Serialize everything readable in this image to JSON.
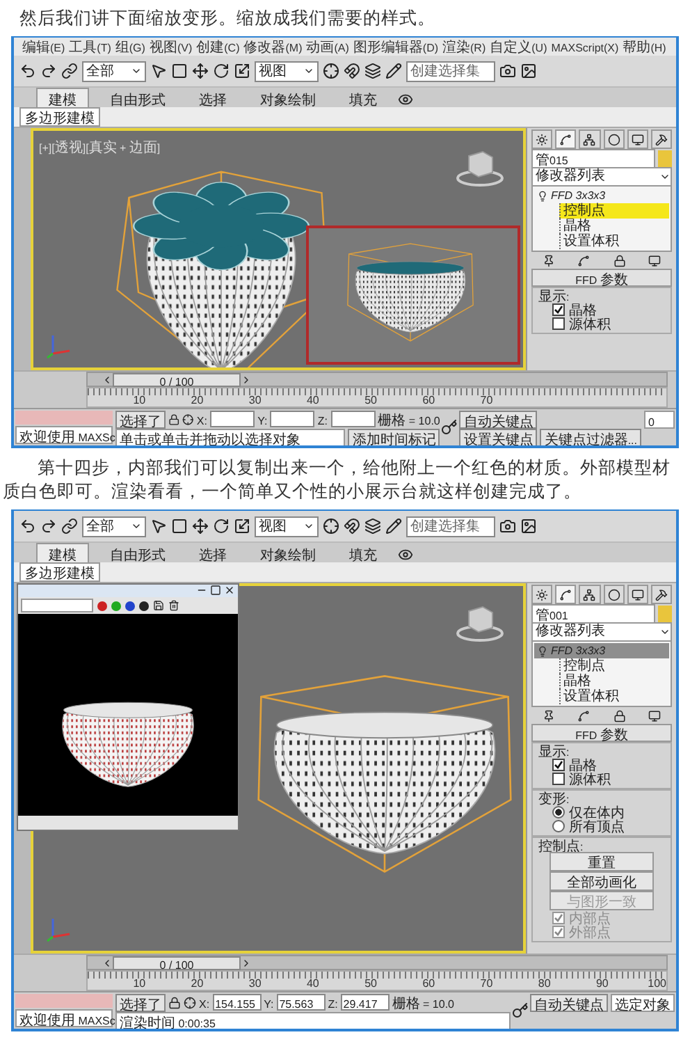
{
  "heading": "然后我们讲下面缩放变形。缩放成我们需要的样式。",
  "screenshot_1": {
    "menu": [
      {
        "label": "编辑",
        "key": "(E)"
      },
      {
        "label": "工具",
        "key": "(T)"
      },
      {
        "label": "组",
        "key": "(G)"
      },
      {
        "label": "视图",
        "key": "(V)"
      },
      {
        "label": "创建",
        "key": "(C)"
      },
      {
        "label": "修改器",
        "key": "(M)"
      },
      {
        "label": "动画",
        "key": "(A)"
      },
      {
        "label": "图形编辑器",
        "key": "(D)"
      },
      {
        "label": "渲染",
        "key": "(R)"
      },
      {
        "label": "自定义",
        "key": "(U)"
      },
      {
        "key": "MAXScript(X)"
      },
      {
        "label": "帮助",
        "key": "(H)"
      }
    ],
    "toolbar": {
      "selection_filter": "全部",
      "coordinate_system": "视图",
      "named_selection": {
        "placeholder": "创建选择集"
      }
    },
    "ribbon_tabs": [
      {
        "label": "建模",
        "selected": true
      },
      {
        "label": "自由形式",
        "selected": false
      },
      {
        "label": "选择",
        "selected": false
      },
      {
        "label": "对象绘制",
        "selected": false
      },
      {
        "label": "填充",
        "selected": false
      }
    ],
    "ribbon_panel": "多边形建模",
    "viewport": {
      "label": "[+][透视][真实 + 边面]",
      "kind": "tall"
    },
    "overlay": {
      "kind": "render_inset"
    },
    "command_panel": {
      "panel_tabs": [
        {
          "selected": false
        },
        {
          "selected": true
        },
        {
          "selected": false
        },
        {
          "selected": false
        },
        {
          "selected": false
        },
        {
          "selected": false
        }
      ],
      "object_name": "管015",
      "modifier_list": "修改器列表",
      "modifier_stack": [
        {
          "label": "FFD 3x3x3",
          "selected": false,
          "children": [
            {
              "label": "控制点",
              "selected": true
            },
            {
              "label": "晶格",
              "selected": false
            },
            {
              "label": "设置体积",
              "selected": false
            }
          ]
        }
      ],
      "rollout": "FFD 参数",
      "groups": [
        {
          "title": "显示:",
          "options": [
            {
              "kind": "checkbox",
              "label": "晶格",
              "checked": true,
              "disabled": false
            },
            {
              "kind": "checkbox",
              "label": "源体积",
              "checked": false,
              "disabled": false
            }
          ]
        }
      ]
    },
    "timeline": {
      "position": "0 / 100",
      "ticks": [
        "10",
        "20",
        "30",
        "40",
        "50",
        "60",
        "70"
      ]
    },
    "status": {
      "selected_label": "选择了",
      "coordinates": [
        {
          "axis": "X:"
        },
        {
          "axis": "Y:"
        },
        {
          "axis": "Z:"
        }
      ],
      "grid": "栅格 = 10.0",
      "auto_key": "自动关键点",
      "set_key": "设置关键点",
      "key_filters": "关键点过滤器...",
      "frame": "0",
      "maxscript": "欢迎使用 MAXSc",
      "prompt": "单击或单击并拖动以选择对象",
      "time_tag": "添加时间标记"
    }
  },
  "paragraph": "第十四步，内部我们可以复制出来一个，给他附上一个红色的材质。外部模型材质白色即可。渲染看看，一个简单又个性的小展示台就这样创建完成了。",
  "screenshot_2": {
    "toolbar": {
      "selection_filter": "全部",
      "coordinate_system": "视图",
      "named_selection": {
        "placeholder": "创建选择集"
      }
    },
    "ribbon_tabs": [
      {
        "label": "建模",
        "selected": true
      },
      {
        "label": "自由形式",
        "selected": false
      },
      {
        "label": "选择",
        "selected": false
      },
      {
        "label": "对象绘制",
        "selected": false
      },
      {
        "label": "填充",
        "selected": false
      }
    ],
    "ribbon_panel": "多边形建模",
    "viewport": {
      "kind": "wide"
    },
    "overlay": {
      "kind": "frame_buffer"
    },
    "command_panel": {
      "panel_tabs": [
        {
          "selected": false
        },
        {
          "selected": true
        },
        {
          "selected": false
        },
        {
          "selected": false
        },
        {
          "selected": false
        },
        {
          "selected": false
        }
      ],
      "object_name": "管001",
      "modifier_list": "修改器列表",
      "modifier_stack": [
        {
          "label": "FFD 3x3x3",
          "selected": true,
          "children": [
            {
              "label": "控制点",
              "selected": false
            },
            {
              "label": "晶格",
              "selected": false
            },
            {
              "label": "设置体积",
              "selected": false
            }
          ]
        }
      ],
      "rollout": "FFD 参数",
      "groups": [
        {
          "title": "显示:",
          "options": [
            {
              "kind": "checkbox",
              "label": "晶格",
              "checked": true,
              "disabled": false
            },
            {
              "kind": "checkbox",
              "label": "源体积",
              "checked": false,
              "disabled": false
            }
          ]
        },
        {
          "title": "变形:",
          "options": [
            {
              "kind": "radio",
              "label": "仅在体内",
              "selected": true,
              "disabled": false
            },
            {
              "kind": "radio",
              "label": "所有顶点",
              "selected": false,
              "disabled": false
            }
          ]
        },
        {
          "title": "控制点:",
          "options": [
            {
              "kind": "button",
              "label": "重置",
              "disabled": false
            },
            {
              "kind": "button",
              "label": "全部动画化",
              "disabled": false
            },
            {
              "kind": "button",
              "label": "与图形一致",
              "disabled": true
            },
            {
              "kind": "checkbox",
              "label": "内部点",
              "checked": true,
              "disabled": true
            },
            {
              "kind": "checkbox",
              "label": "外部点",
              "checked": true,
              "disabled": true
            }
          ]
        }
      ]
    },
    "timeline": {
      "position": "0 / 100",
      "ticks": [
        "10",
        "20",
        "30",
        "40",
        "50",
        "60",
        "70",
        "80",
        "90",
        "100"
      ]
    },
    "status": {
      "selected_label": "选择了",
      "coordinates": [
        {
          "axis": "X:",
          "value": "154.155"
        },
        {
          "axis": "Y:",
          "value": "75.563"
        },
        {
          "axis": "Z:",
          "value": "29.417"
        }
      ],
      "grid": "栅格 = 10.0",
      "auto_key": "自动关键点",
      "key_mode": "选定对象",
      "maxscript": "欢迎使用 MAXSc",
      "prompt": "渲染时间 0:00:35"
    }
  }
}
